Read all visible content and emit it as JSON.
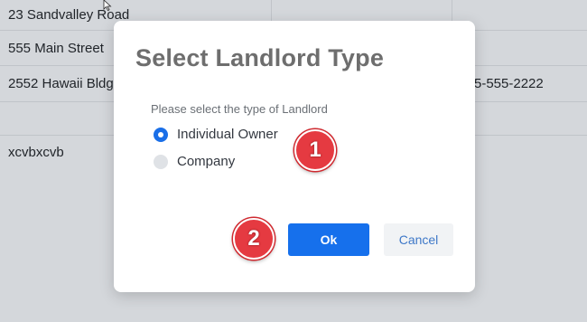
{
  "background_table": {
    "rows": [
      {
        "c1": "23 Sandvalley Road",
        "c2": "",
        "c3": ""
      },
      {
        "c1": "555 Main Street",
        "c2": "",
        "c3": ""
      },
      {
        "c1": "2552 Hawaii Bldg",
        "c2": "",
        "c3": "5-555-2222"
      },
      {
        "c1": "",
        "c2": "",
        "c3": ""
      },
      {
        "c1": "xcvbxcvb",
        "c2": "",
        "c3": ""
      }
    ]
  },
  "modal": {
    "title": "Select Landlord Type",
    "prompt": "Please select the type of Landlord",
    "options": [
      {
        "label": "Individual Owner",
        "selected": true
      },
      {
        "label": "Company",
        "selected": false
      }
    ],
    "ok_label": "Ok",
    "cancel_label": "Cancel"
  },
  "annotations": {
    "badge_1": "1",
    "badge_2": "2"
  },
  "colors": {
    "primary": "#1670ec",
    "badge": "#e53a41",
    "overlay_bg": "#d4d7db"
  }
}
